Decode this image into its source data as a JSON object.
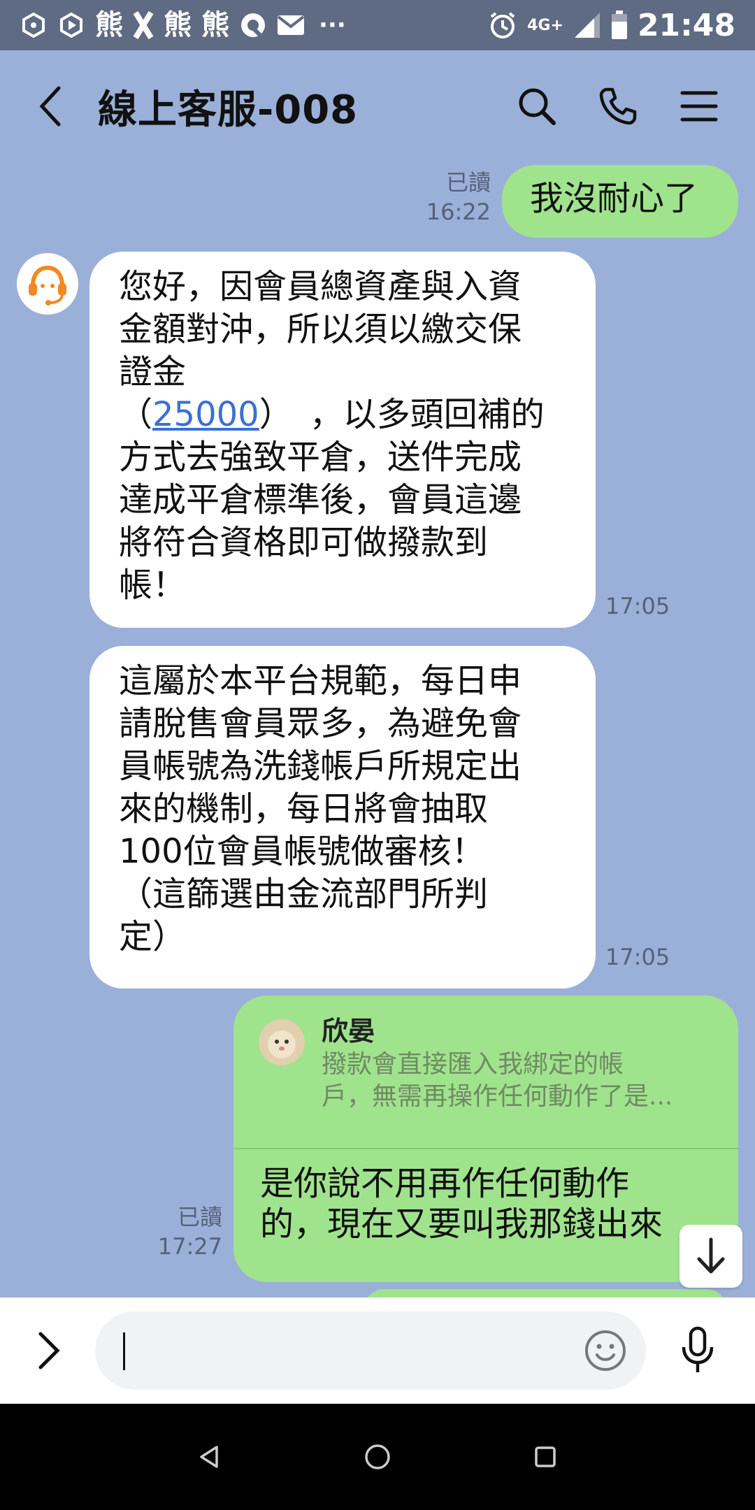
{
  "status_bar": {
    "time": "21:48",
    "app_icons": [
      "熊",
      "熊",
      "熊"
    ],
    "network": "4G+",
    "dots": "···"
  },
  "header": {
    "title": "線上客服-008"
  },
  "messages": [
    {
      "side": "right",
      "read_label": "已讀",
      "time": "16:22",
      "text": "我沒耐心了"
    },
    {
      "side": "left",
      "time": "17:05",
      "lines": [
        "您好，因會員總資產與入資",
        "金額對沖，所以須以繳交保",
        "證金"
      ],
      "amount_open": "（",
      "amount": "25000",
      "amount_close": "）　，以多頭回補的",
      "lines_after": [
        "方式去強致平倉，送件完成",
        "達成平倉標準後，會員這邊",
        "將符合資格即可做撥款到",
        "帳！"
      ]
    },
    {
      "side": "left",
      "time": "17:05",
      "lines": [
        "這屬於本平台規範，每日申",
        "請脫售會員眾多，為避免會",
        "員帳號為洗錢帳戶所規定出",
        "來的機制，每日將會抽取",
        "100位會員帳號做審核！",
        "（這篩選由金流部門所判",
        "定）"
      ]
    },
    {
      "side": "right",
      "read_label": "已讀",
      "time": "17:27",
      "quote_name": "欣晏",
      "quote_lines": [
        "撥款會直接匯入我綁定的帳",
        "戶，無需再操作任何動作了是..."
      ],
      "reply_lines": [
        "是你說不用再作任何動作",
        "的，現在又要叫我那錢出來"
      ]
    }
  ],
  "input": {
    "placeholder": ""
  },
  "icons": {
    "back": "back-arrow-icon",
    "search": "search-icon",
    "call": "phone-icon",
    "menu": "menu-icon",
    "expand": "chevron-right-icon",
    "emoji": "emoji-icon",
    "mic": "microphone-icon",
    "scroll": "arrow-down-icon"
  },
  "colors": {
    "chat_bg": "#9bb0d8",
    "green_bubble": "#a0e38d",
    "white_bubble": "#ffffff",
    "link": "#3a6fd8",
    "status_bar": "#5e6b82"
  }
}
